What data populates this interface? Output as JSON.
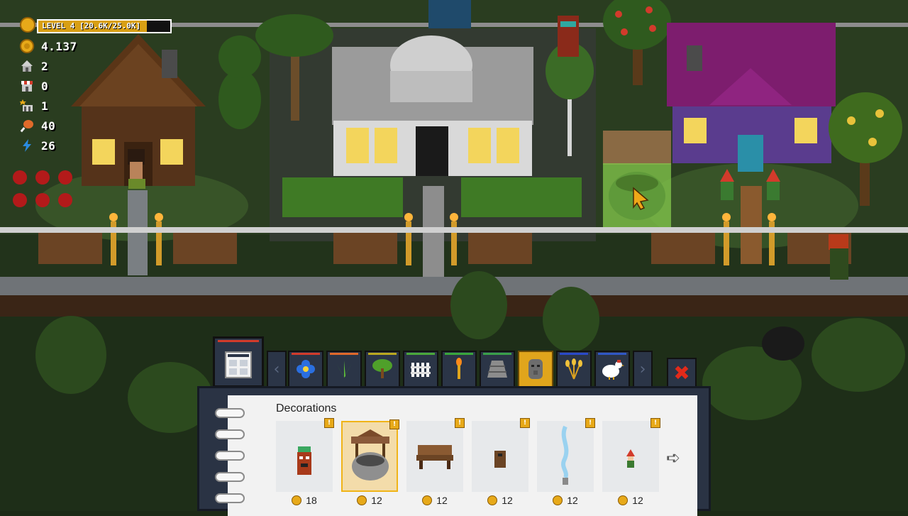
{
  "hud": {
    "level_label": "LEVEL 4",
    "xp_text": "[20.6K/25.0K]",
    "xp_progress": 0.824,
    "coins": "4.137",
    "houses": "2",
    "shops": "0",
    "attractions": "1",
    "food": "40",
    "energy": "26"
  },
  "build_menu": {
    "categories": [
      {
        "icon": "flower-icon",
        "line_color": "#d23b2b"
      },
      {
        "icon": "plant-icon",
        "line_color": "#e0682a"
      },
      {
        "icon": "tree-icon",
        "line_color": "#b9a71f"
      },
      {
        "icon": "fence-icon",
        "line_color": "#4aa83a"
      },
      {
        "icon": "torch-icon",
        "line_color": "#39a63c"
      },
      {
        "icon": "path-icon",
        "line_color": "#3aa04a"
      },
      {
        "icon": "statue-icon",
        "line_color": "#e0a51c",
        "active": true
      },
      {
        "icon": "wheat-icon",
        "line_color": "#2a49c8"
      },
      {
        "icon": "chicken-icon",
        "line_color": "#3057c4"
      }
    ],
    "panel_title": "Decorations",
    "items": [
      {
        "icon": "tiki-totem-icon",
        "price": "18"
      },
      {
        "icon": "stone-well-icon",
        "price": "12",
        "selected": true
      },
      {
        "icon": "wooden-bench-icon",
        "price": "12"
      },
      {
        "icon": "trash-bin-icon",
        "price": "12"
      },
      {
        "icon": "fountain-icon",
        "price": "12"
      },
      {
        "icon": "garden-gnome-icon",
        "price": "12"
      }
    ]
  },
  "colors": {
    "accent": "#e0a51c",
    "panel": "#2a3344",
    "close": "#e22a1a"
  }
}
